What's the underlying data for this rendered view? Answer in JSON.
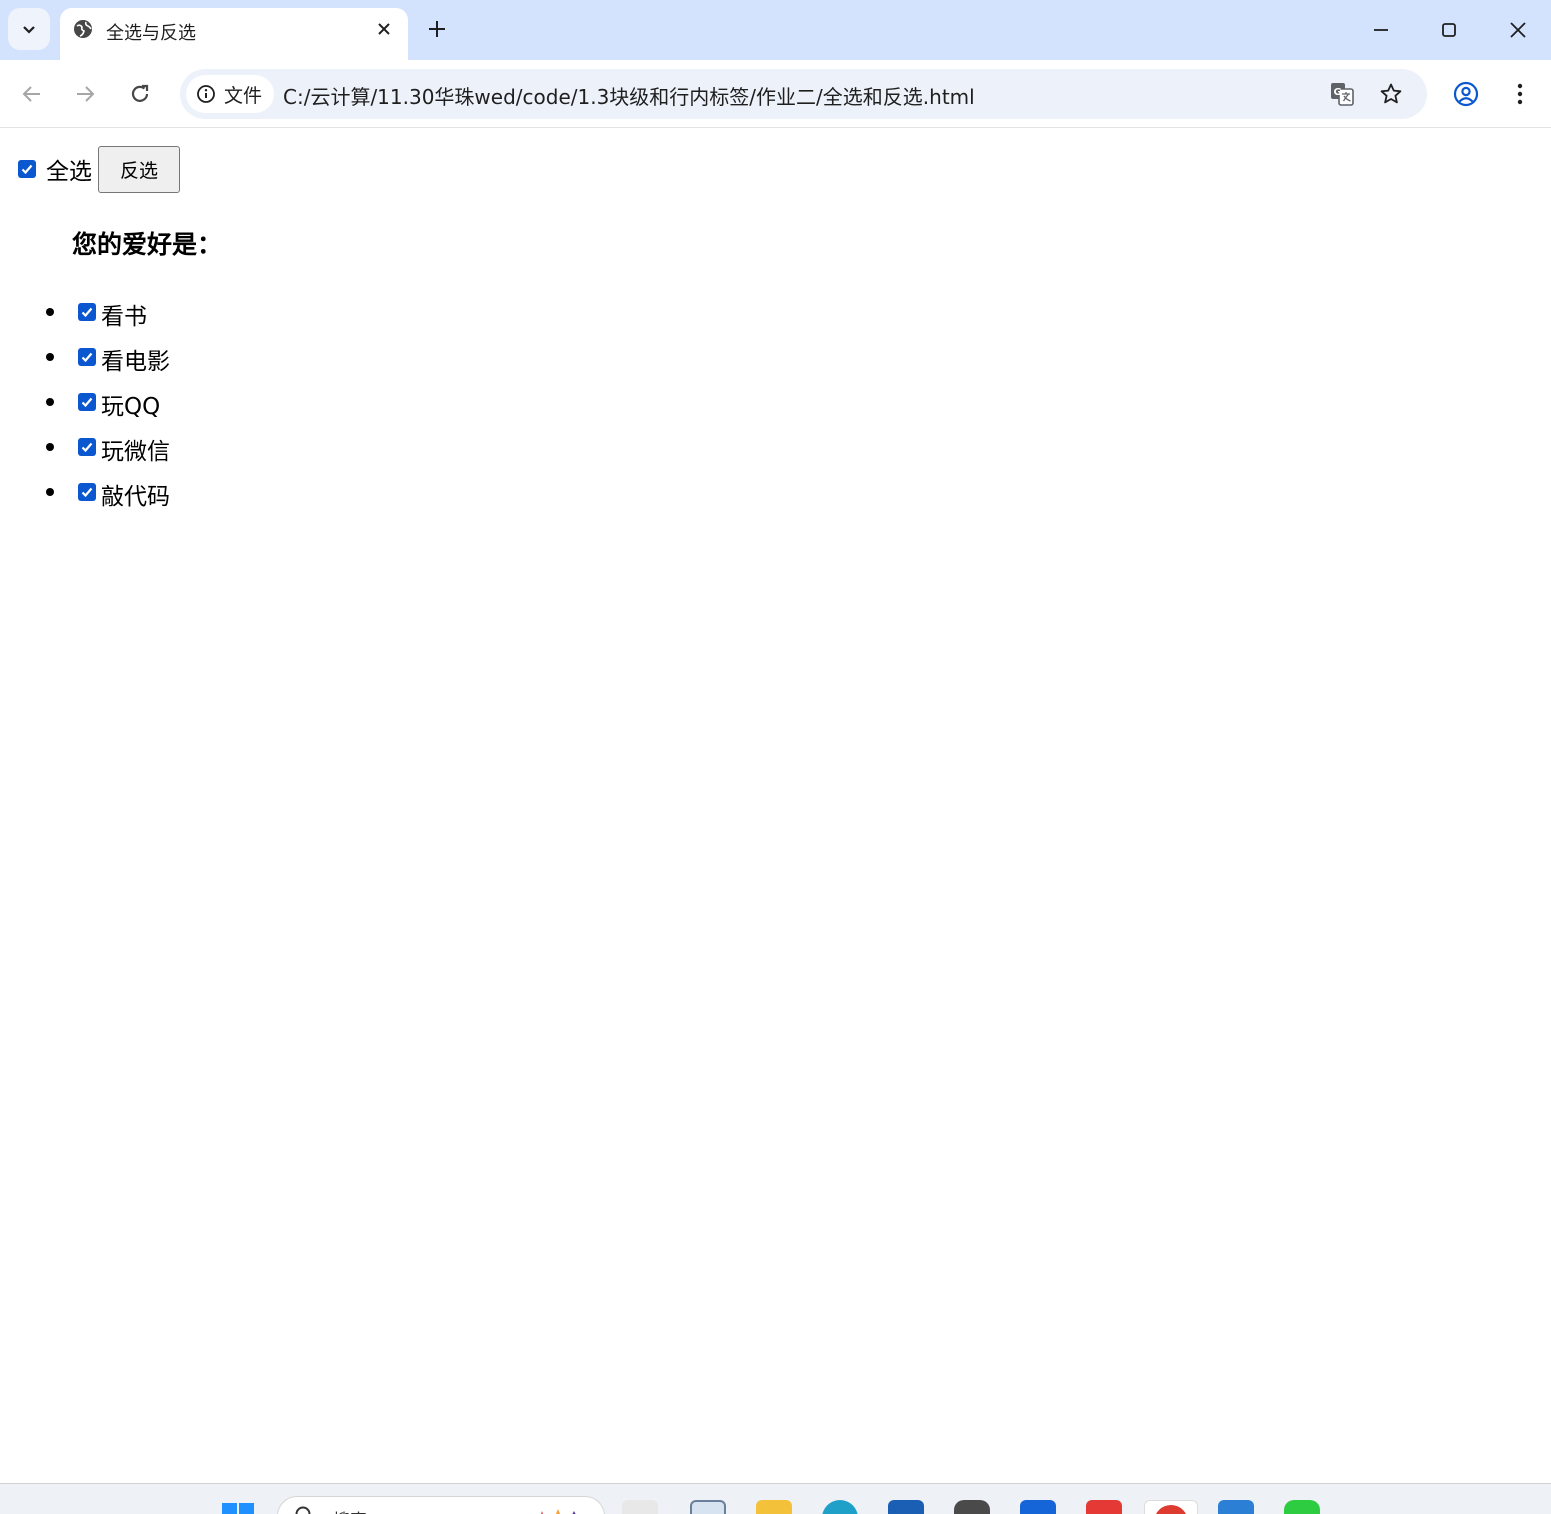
{
  "browser": {
    "tab_title": "全选与反选",
    "url_chip_label": "文件",
    "url": "C:/云计算/11.30华珠wed/code/1.3块级和行内标签/作业二/全选和反选.html",
    "icons": {
      "tab_search": "chevron-down-icon",
      "favicon": "globe-icon",
      "tab_close": "close-icon",
      "new_tab": "plus-icon",
      "minimize": "minimize-icon",
      "maximize": "maximize-icon",
      "close": "close-icon",
      "back": "arrow-left-icon",
      "forward": "arrow-right-icon",
      "reload": "reload-icon",
      "site_info": "info-icon",
      "translate": "translate-icon",
      "bookmark": "star-icon",
      "profile": "profile-icon",
      "menu": "kebab-menu-icon"
    }
  },
  "page": {
    "select_all_label": "全选",
    "select_all_checked": true,
    "invert_button_label": "反选",
    "heading": "您的爱好是：",
    "hobbies": [
      {
        "label": "看书",
        "checked": true
      },
      {
        "label": "看电影",
        "checked": true
      },
      {
        "label": "玩QQ",
        "checked": true
      },
      {
        "label": "玩微信",
        "checked": true
      },
      {
        "label": "敲代码",
        "checked": true
      }
    ]
  },
  "taskbar": {
    "search_placeholder": "搜索",
    "accent_color": "#0b57d0"
  }
}
